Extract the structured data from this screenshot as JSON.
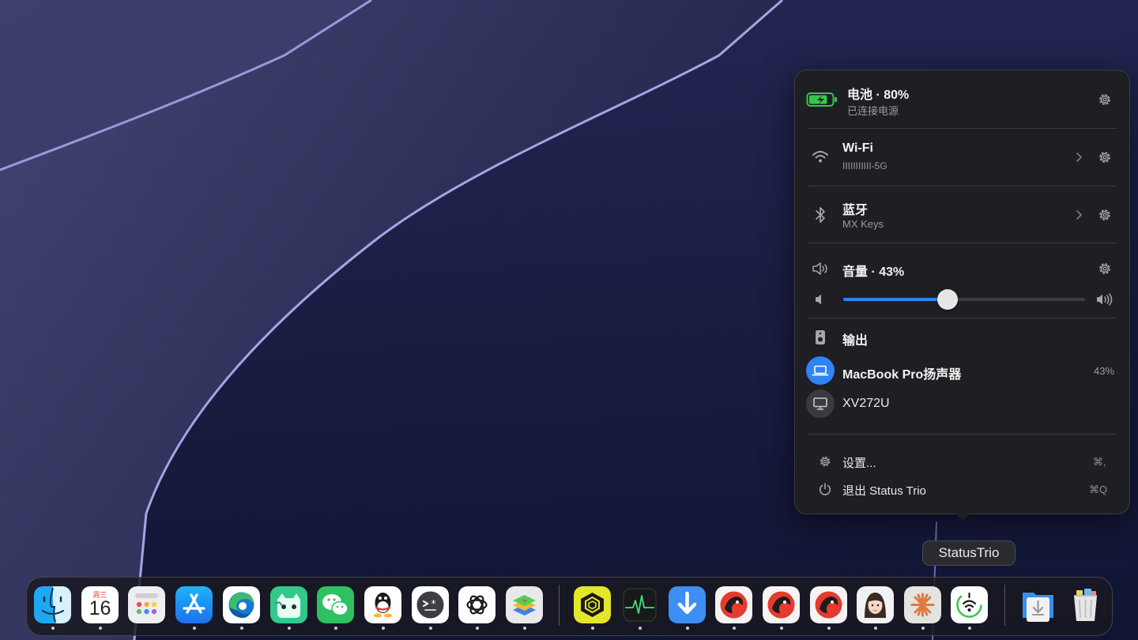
{
  "battery": {
    "title": "电池 · 80%",
    "status": "已连接电源",
    "level_percent": 80,
    "color": "#37c64b"
  },
  "wifi": {
    "title": "Wi-Fi",
    "network": "IIIIIIIIIII-5G"
  },
  "bluetooth": {
    "title": "蓝牙",
    "device": "MX Keys"
  },
  "volume": {
    "title": "音量 · 43%",
    "level_percent": 43,
    "accent": "#2f83f4"
  },
  "output": {
    "title": "输出",
    "devices": [
      {
        "name": "MacBook Pro扬声器",
        "value": "43%",
        "selected": true
      },
      {
        "name": "XV272U",
        "value": "",
        "selected": false
      }
    ]
  },
  "menu": {
    "settings_label": "设置...",
    "settings_shortcut": "⌘,",
    "quit_label": "退出 Status Trio",
    "quit_shortcut": "⌘Q"
  },
  "tooltip": {
    "text": "StatusTrio"
  },
  "dock": {
    "calendar_weekday": "周三",
    "calendar_day": "16",
    "apps": [
      {
        "icon": "finder-icon",
        "running": true
      },
      {
        "icon": "calendar-icon",
        "running": true
      },
      {
        "icon": "launchpad-icon",
        "running": false
      },
      {
        "icon": "app-store-icon",
        "running": true
      },
      {
        "icon": "edge-icon",
        "running": true
      },
      {
        "icon": "cat-app-icon",
        "running": true
      },
      {
        "icon": "wechat-icon",
        "running": true
      },
      {
        "icon": "qq-icon",
        "running": true
      },
      {
        "icon": "terminal-icon",
        "running": true
      },
      {
        "icon": "chatgpt-icon",
        "running": true
      },
      {
        "icon": "bluestacks-icon",
        "running": true
      },
      {
        "icon": "cube-app-icon",
        "running": true
      },
      {
        "icon": "activity-monitor-icon",
        "running": true
      },
      {
        "icon": "downloader-icon",
        "running": true
      },
      {
        "icon": "red-app-1-icon",
        "running": true
      },
      {
        "icon": "red-app-2-icon",
        "running": true
      },
      {
        "icon": "red-app-3-icon",
        "running": true
      },
      {
        "icon": "avatar-app-icon",
        "running": true
      },
      {
        "icon": "claude-icon",
        "running": true
      },
      {
        "icon": "status-trio-icon",
        "running": true
      },
      {
        "icon": "downloads-folder-icon",
        "running": false
      },
      {
        "icon": "trash-icon",
        "running": false
      }
    ]
  }
}
